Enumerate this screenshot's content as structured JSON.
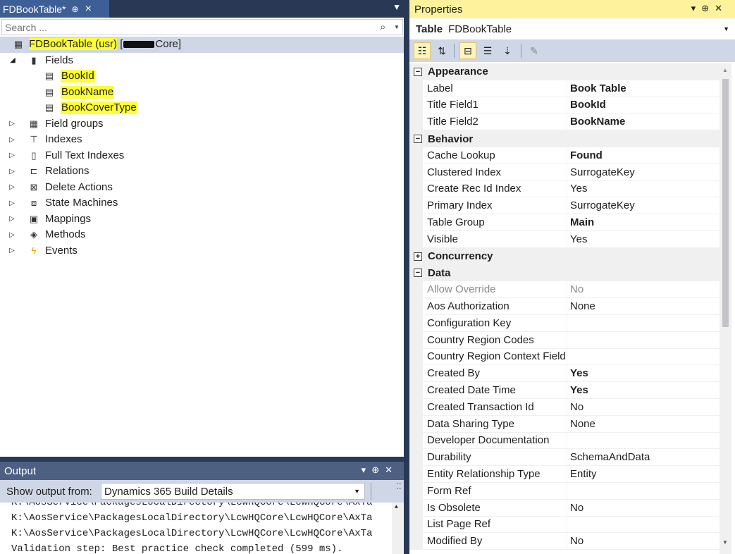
{
  "designer": {
    "tab_title": "FDBookTable*",
    "pin_glyph": "⊕",
    "close_glyph": "✕",
    "search_placeholder": "Search ...",
    "tree": {
      "root_label": "FDBookTable (usr)",
      "root_suffix_open": " [",
      "root_suffix_close": "Core]",
      "fields_label": "Fields",
      "fields": [
        "BookId",
        "BookName",
        "BookCoverType"
      ],
      "nodes": [
        "Field groups",
        "Indexes",
        "Full Text Indexes",
        "Relations",
        "Delete Actions",
        "State Machines",
        "Mappings",
        "Methods",
        "Events"
      ]
    }
  },
  "output": {
    "title": "Output",
    "show_from_label": "Show output from:",
    "source": "Dynamics 365 Build Details",
    "lines": [
      "K:\\AosService\\PackagesLocalDirectory\\LcwHQCore\\LcwHQCore\\AxTa",
      "K:\\AosService\\PackagesLocalDirectory\\LcwHQCore\\LcwHQCore\\AxTa",
      "K:\\AosService\\PackagesLocalDirectory\\LcwHQCore\\LcwHQCore\\AxTa",
      "Validation step: Best practice check completed (599 ms)."
    ]
  },
  "properties": {
    "title": "Properties",
    "object_type": "Table",
    "object_name": "FDBookTable",
    "categories": {
      "appearance": "Appearance",
      "behavior": "Behavior",
      "concurrency": "Concurrency",
      "data": "Data"
    },
    "appearance": [
      {
        "name": "Label",
        "value": "Book Table"
      },
      {
        "name": "Title Field1",
        "value": "BookId"
      },
      {
        "name": "Title Field2",
        "value": "BookName"
      }
    ],
    "behavior": [
      {
        "name": "Cache Lookup",
        "value": "Found"
      },
      {
        "name": "Clustered Index",
        "value": "SurrogateKey"
      },
      {
        "name": "Create Rec Id Index",
        "value": "Yes"
      },
      {
        "name": "Primary Index",
        "value": "SurrogateKey"
      },
      {
        "name": "Table Group",
        "value": "Main"
      },
      {
        "name": "Visible",
        "value": "Yes"
      }
    ],
    "data": [
      {
        "name": "Allow Override",
        "value": "No"
      },
      {
        "name": "Aos Authorization",
        "value": "None"
      },
      {
        "name": "Configuration Key",
        "value": ""
      },
      {
        "name": "Country Region Codes",
        "value": ""
      },
      {
        "name": "Country Region Context Field",
        "value": ""
      },
      {
        "name": "Created By",
        "value": "Yes"
      },
      {
        "name": "Created Date Time",
        "value": "Yes"
      },
      {
        "name": "Created Transaction Id",
        "value": "No"
      },
      {
        "name": "Data Sharing Type",
        "value": "None"
      },
      {
        "name": "Developer Documentation",
        "value": ""
      },
      {
        "name": "Durability",
        "value": "SchemaAndData"
      },
      {
        "name": "Entity Relationship Type",
        "value": "Entity"
      },
      {
        "name": "Form Ref",
        "value": ""
      },
      {
        "name": "Is Obsolete",
        "value": "No"
      },
      {
        "name": "List Page Ref",
        "value": ""
      },
      {
        "name": "Modified By",
        "value": "No"
      }
    ]
  },
  "colors": {
    "frame": "#293955",
    "active_tab": "#3e5f96",
    "highlight": "#fefe35",
    "properties_title": "#fff29d",
    "toolbar": "#cfd6e5"
  }
}
